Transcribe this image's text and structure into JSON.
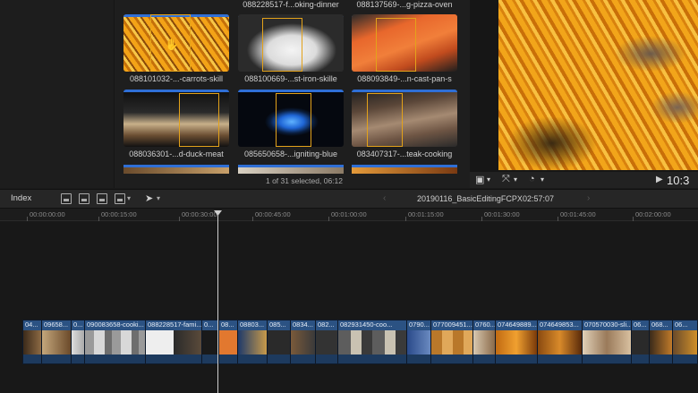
{
  "browser": {
    "clips": [
      {
        "name": "088101032-...-carrots-skill",
        "skimmed": true
      },
      {
        "name": "088228517-f...oking-dinner",
        "skimmed": false
      },
      {
        "name": "088137569-...g-pizza-oven",
        "skimmed": false
      },
      {
        "name": "088100669-...st-iron-skille",
        "skimmed": false
      },
      {
        "name": "088093849-...n-cast-pan-s",
        "skimmed": false
      },
      {
        "name": "088036301-...d-duck-meat",
        "skimmed": false
      },
      {
        "name": "085650658-...igniting-blue",
        "skimmed": false
      },
      {
        "name": "083407317-...teak-cooking",
        "skimmed": false
      }
    ],
    "status": "1 of 31 selected, 06:12"
  },
  "viewer": {
    "timecode": "10:3"
  },
  "timeline": {
    "index_label": "Index",
    "project_name": "20190116_BasicEditingFCPX",
    "project_duration": "02:57:07",
    "ruler": [
      "00:00:00:00",
      "00:00:15:00",
      "00:00:30:00",
      "00:00:45:00",
      "00:01:00:00",
      "00:01:15:00",
      "00:01:30:00",
      "00:01:45:00",
      "00:02:00:00"
    ],
    "clips": [
      "04...",
      "09658...",
      "0...",
      "090083658-cooki...",
      "088228517-fami...",
      "0...",
      "08...",
      "08803...",
      "085...",
      "0834...",
      "082...",
      "082931450-coo...",
      "0790...",
      "077009451...",
      "0760...",
      "074649889...",
      "074649853...",
      "070570030-sli...",
      "06...",
      "068...",
      "06..."
    ]
  },
  "colors": {
    "selection_bar": "#2f6fd6",
    "skim_frame": "#e3a21a",
    "clip_blue": "#24466e"
  }
}
